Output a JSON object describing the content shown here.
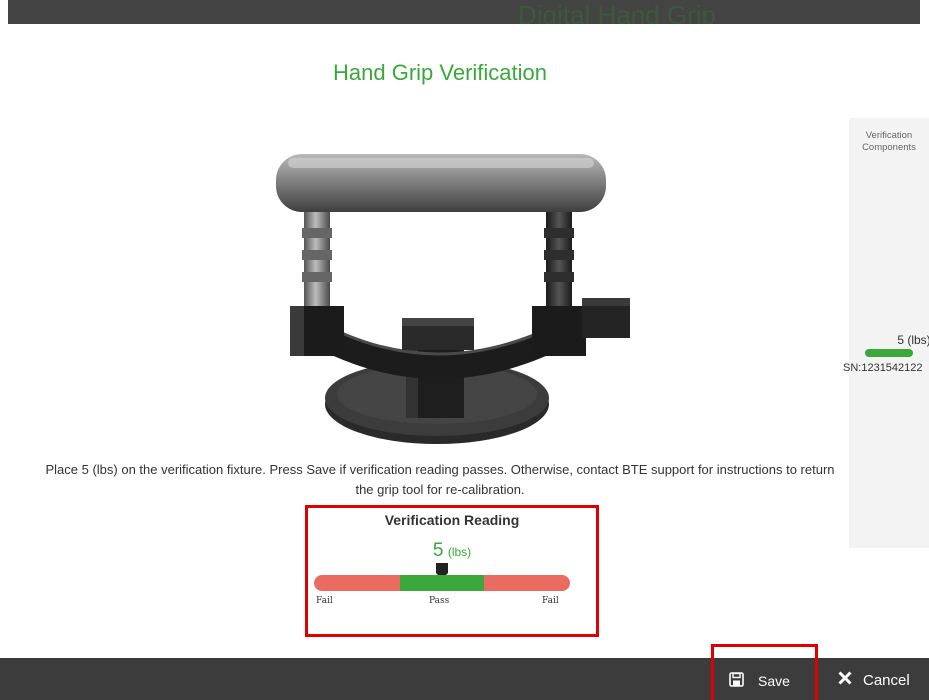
{
  "header": {
    "title": "Digital Hand Grip"
  },
  "page": {
    "title": "Hand Grip Verification"
  },
  "side_panel": {
    "title": "Verification Components",
    "component": {
      "value": "5",
      "unit": "(lbs)",
      "serial": "SN:1231542122"
    }
  },
  "instructions": "Place 5 (lbs) on the verification fixture. Press Save if verification reading passes. Otherwise, contact BTE support for instructions to return the grip tool for re-calibration.",
  "reading": {
    "title": "Verification Reading",
    "value": "5",
    "unit": "(lbs)",
    "labels": {
      "fail_left": "Fail",
      "pass": "Pass",
      "fail_right": "Fail"
    },
    "marker_fraction": 0.5
  },
  "footer": {
    "save_label": "Save",
    "cancel_label": "Cancel"
  },
  "icons": {
    "save": "save-icon",
    "cancel": "close-icon",
    "marker": "marker-icon"
  },
  "colors": {
    "accent": "#3aa83a",
    "fail": "#ea6b5f",
    "highlight": "#e00000",
    "footer": "#3c3c3c"
  }
}
